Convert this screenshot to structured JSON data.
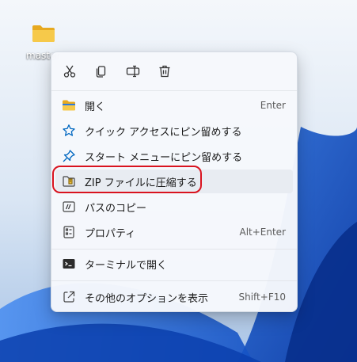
{
  "desktop": {
    "folder_label": "master"
  },
  "quick_actions": [
    {
      "name": "cut-button",
      "icon": "scissors-icon"
    },
    {
      "name": "copy-button",
      "icon": "copy-icon"
    },
    {
      "name": "rename-button",
      "icon": "rename-icon"
    },
    {
      "name": "delete-button",
      "icon": "trash-icon"
    }
  ],
  "menu": {
    "items": [
      {
        "label": "開く",
        "shortcut": "Enter",
        "icon": "folder-icon"
      },
      {
        "label": "クイック アクセスにピン留めする",
        "shortcut": "",
        "icon": "star-icon"
      },
      {
        "label": "スタート メニューにピン留めする",
        "shortcut": "",
        "icon": "pin-icon"
      },
      {
        "label": "ZIP ファイルに圧縮する",
        "shortcut": "",
        "icon": "zip-icon"
      },
      {
        "label": "パスのコピー",
        "shortcut": "",
        "icon": "path-copy-icon"
      },
      {
        "label": "プロパティ",
        "shortcut": "Alt+Enter",
        "icon": "properties-icon"
      },
      {
        "label": "ターミナルで開く",
        "shortcut": "",
        "icon": "terminal-icon"
      },
      {
        "label": "その他のオプションを表示",
        "shortcut": "Shift+F10",
        "icon": "more-options-icon"
      }
    ]
  },
  "colors": {
    "highlight_ring": "#d9131f",
    "accent": "#0067c0",
    "folder": "#f6c94a"
  }
}
